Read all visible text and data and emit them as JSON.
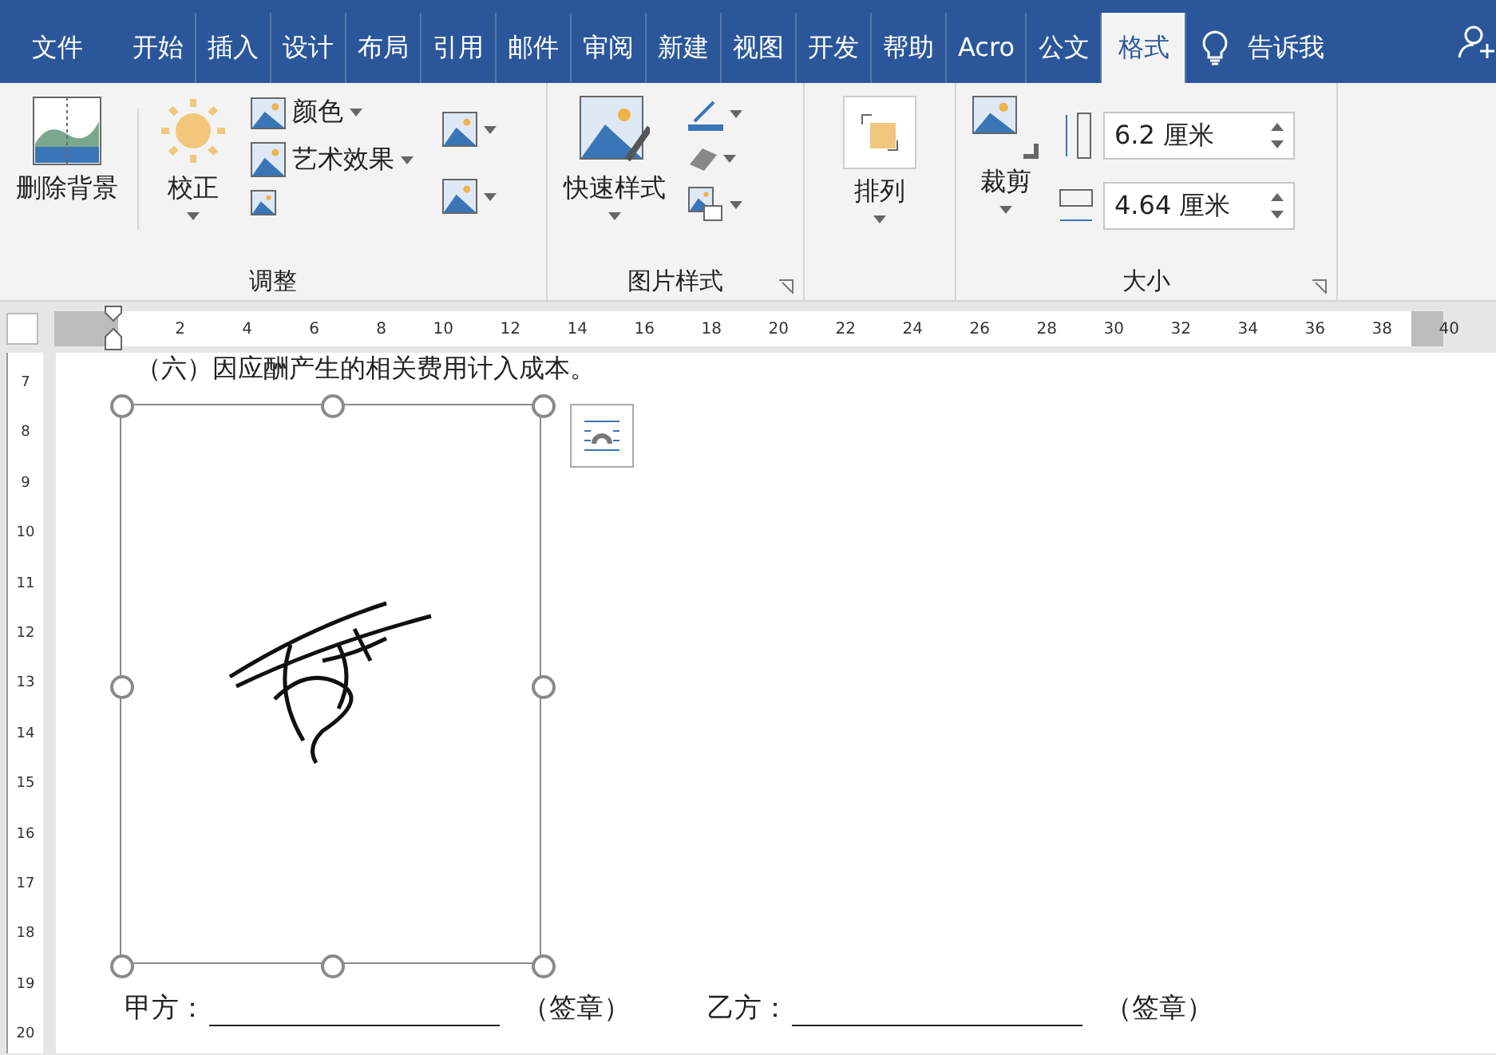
{
  "tabs": [
    {
      "label": "文件",
      "selected": false
    },
    {
      "label": "开始",
      "selected": false
    },
    {
      "label": "插入",
      "selected": false
    },
    {
      "label": "设计",
      "selected": false
    },
    {
      "label": "布局",
      "selected": false
    },
    {
      "label": "引用",
      "selected": false
    },
    {
      "label": "邮件",
      "selected": false
    },
    {
      "label": "审阅",
      "selected": false
    },
    {
      "label": "新建",
      "selected": false
    },
    {
      "label": "视图",
      "selected": false
    },
    {
      "label": "开发",
      "selected": false
    },
    {
      "label": "帮助",
      "selected": false
    },
    {
      "label": "Acro",
      "selected": false
    },
    {
      "label": "公文",
      "selected": false
    },
    {
      "label": "格式",
      "selected": true
    }
  ],
  "tell_me": "告诉我",
  "ribbon": {
    "adjust": {
      "label": "调整",
      "remove_background": "删除背景",
      "corrections": "校正",
      "recolor": "颜色",
      "artistic_effects": "艺术效果"
    },
    "picture_styles": {
      "label": "图片样式",
      "quick_styles": "快速样式"
    },
    "arrange": {
      "button": "排列"
    },
    "size": {
      "label": "大小",
      "crop": "裁剪",
      "height": "6.2 厘米",
      "width": "4.64 厘米"
    }
  },
  "ruler": {
    "horizontal": [
      "2",
      "4",
      "6",
      "8",
      "10",
      "12",
      "14",
      "16",
      "18",
      "20",
      "22",
      "24",
      "26",
      "28",
      "30",
      "32",
      "34",
      "36",
      "38",
      "40"
    ],
    "vertical": [
      "7",
      "8",
      "9",
      "10",
      "11",
      "12",
      "13",
      "14",
      "15",
      "16",
      "17",
      "18",
      "19",
      "20"
    ]
  },
  "document": {
    "paragraph": "（六）因应酬产生的相关费用计入成本。",
    "signatures": [
      {
        "party": "甲方：",
        "seal": "（签章）"
      },
      {
        "party": "乙方：",
        "seal": "（签章）"
      }
    ]
  }
}
